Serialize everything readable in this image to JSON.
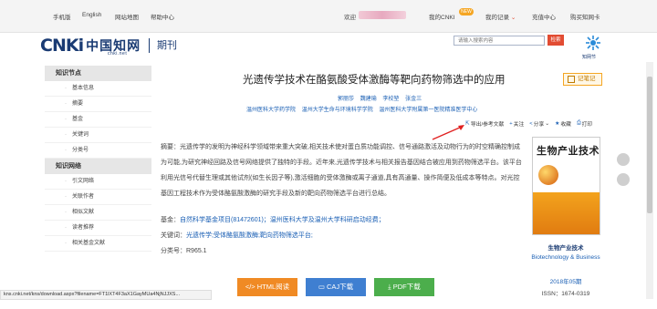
{
  "topbar": {
    "links": [
      "手机版",
      "English",
      "网站地图",
      "帮助中心"
    ],
    "welcome": "欢迎",
    "my_cnki": "我的CNKI",
    "new_badge": "NEW",
    "my_records": "我的记录",
    "recharge": "充值中心",
    "buy_card": "购买知网卡"
  },
  "header": {
    "logo_text": "CNKi",
    "logo_cn": "中国知网",
    "logo_sub": "cnki.net",
    "section": "期刊",
    "search_placeholder": "请输入搜索内容",
    "search_button": "检索",
    "brand_right": "知网节"
  },
  "sidebar": {
    "node_heading": "知识节点",
    "node_items": [
      "基本信息",
      "摘要",
      "基金",
      "关键词",
      "分类号"
    ],
    "network_heading": "知识网络",
    "network_items": [
      "引文网络",
      "关联作者",
      "相似文献",
      "读者推荐",
      "相关基金文献"
    ]
  },
  "article": {
    "title": "光遗传学技术在酪氨酸受体激酶等靶向药物筛选中的应用",
    "note_button": "记笔记",
    "authors": [
      "郭丽莎",
      "魏建瑜",
      "李校堃",
      "张金三"
    ],
    "affiliations": [
      "温州医科大学药学院",
      "温州大学生命与环境科学学院",
      "温州医科大学附属第一医院精准医学中心"
    ],
    "actions": [
      "导出/参考文献",
      "关注",
      "分享",
      "收藏",
      "打印"
    ],
    "abstract_label": "摘要：",
    "abstract_text": "光遗传学的发明为神经科学领域带来重大突破,相关技术使对蛋白质功能调控、信号通路激活及动物行为的时空精确控制成为可能,为研究神经回路及信号网络提供了独特的手段。近年来,光遗传学技术与相关报告基因结合被应用到药物筛选平台。该平台利用光信号代替生理或其他试剂(如生长因子等),激活细胞的受体激酶或离子通道,具有高通量、操作简便及低成本等特点。对光控基因工程技术作为受体酪氨酸激酶的研究手段及新的靶向药物筛选平台进行总结。",
    "fund_label": "基金：",
    "fund_values": [
      "自然科学基金项目(81472601)；",
      "温州医科大学及温州大学科研启动经费；"
    ],
    "keyword_label": "关键词：",
    "keyword_values": [
      "光遗传学;",
      "受体酪氨酸激酶;",
      "靶向药物筛选平台;"
    ],
    "class_label": "分类号：",
    "class_value": "R965.1"
  },
  "buttons": {
    "html": "HTML阅读",
    "caj": "CAJ下载",
    "pdf": "PDF下载"
  },
  "journal": {
    "cover_title": "生物产业技术",
    "name_cn": "生物产业技术",
    "name_en": "Biotechnology & Business",
    "issue": "2018年05期",
    "issn": "ISSN：1674-0319"
  },
  "status_url": "kns.cnki.net/kns/download.aspx?filename=FT1lXT4F3aX1GayMUa4NjNJJXS...",
  "colors": {
    "accent_blue": "#1a5fb4",
    "brand_navy": "#1a3b73",
    "search_red": "#e24c32",
    "html_btn": "#f08a24",
    "caj_btn": "#3f7fd1",
    "pdf_btn": "#4cae4c"
  }
}
